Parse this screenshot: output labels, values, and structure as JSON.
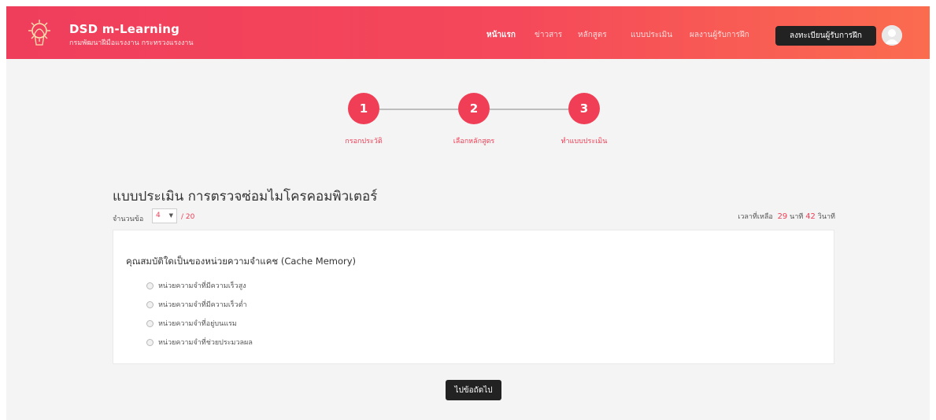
{
  "header": {
    "brand_title": "DSD m-Learning",
    "brand_subtitle": "กรมพัฒนาฝีมือแรงงาน กระทรวงแรงงาน",
    "nav": [
      {
        "label": "หน้าแรก",
        "active": true
      },
      {
        "label": "ข่าวสาร",
        "active": false
      },
      {
        "label": "หลักสูตร",
        "active": false
      },
      {
        "label": "แบบประเมิน",
        "active": false
      },
      {
        "label": "ผลงานผู้รับการฝึก",
        "active": false
      }
    ],
    "register_label": "ลงทะเบียนผู้รับการฝึก",
    "logo_icon": "dsd-logo-icon",
    "avatar_icon": "user-avatar-icon"
  },
  "steps": [
    {
      "number": "1",
      "label": "กรอกประวัติ"
    },
    {
      "number": "2",
      "label": "เลือกหลักสูตร"
    },
    {
      "number": "3",
      "label": "ทำแบบประเมิน"
    }
  ],
  "quiz": {
    "title": "แบบประเมิน การตรวจซ่อมไมโครคอมพิวเตอร์",
    "count_label": "จำนวนข้อ",
    "current_question": "4",
    "total": "/ 20",
    "timer_label": "เวลาที่เหลือ",
    "minutes": "29",
    "minutes_unit": "นาที",
    "seconds": "42",
    "seconds_unit": "วินาที"
  },
  "question": {
    "text": "คุณสมบัติใดเป็นของหน่วยความจำแคช (Cache Memory)",
    "options": [
      "หน่วยความจำที่มีความเร็วสูง",
      "หน่วยความจำที่มีความเร็วต่ำ",
      "หน่วยความจำที่อยู่บนแรม",
      "หน่วยความจำที่ช่วยประมวลผล"
    ]
  },
  "next_label": "ไปข้อถัดไป",
  "colors": {
    "accent": "#ef3e55",
    "header_gradient_start": "#ef3e5c",
    "header_gradient_end": "#fb6c4f",
    "dark_button": "#222222"
  }
}
